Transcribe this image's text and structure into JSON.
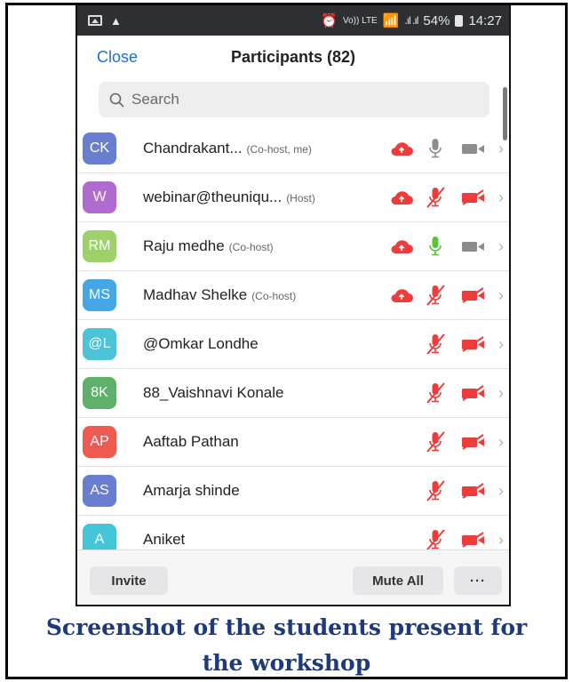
{
  "status_bar": {
    "volte": "Vo)) LTE",
    "signal": ".ıl .ıl",
    "battery_percent": "54%",
    "time": "14:27"
  },
  "header": {
    "close_label": "Close",
    "title": "Participants (82)"
  },
  "search": {
    "placeholder": "Search"
  },
  "participants": [
    {
      "initials": "CK",
      "color": "#6a7ed0",
      "name": "Chandrakant...",
      "role": "(Co-host, me)",
      "cloud": true,
      "mic": "on-grey",
      "cam": "on-grey"
    },
    {
      "initials": "W",
      "color": "#b06ad0",
      "name": "webinar@theuniqu...",
      "role": "(Host)",
      "cloud": true,
      "mic": "muted",
      "cam": "off"
    },
    {
      "initials": "RM",
      "color": "#9ed16a",
      "name": "Raju medhe",
      "role": "(Co-host)",
      "cloud": true,
      "mic": "on-green",
      "cam": "on-grey"
    },
    {
      "initials": "MS",
      "color": "#46a6e6",
      "name": "Madhav Shelke",
      "role": "(Co-host)",
      "cloud": true,
      "mic": "muted",
      "cam": "off"
    },
    {
      "initials": "@L",
      "color": "#4cc3d6",
      "name": "@Omkar Londhe",
      "role": "",
      "cloud": false,
      "mic": "muted",
      "cam": "off"
    },
    {
      "initials": "8K",
      "color": "#5fb06a",
      "name": "88_Vaishnavi Konale",
      "role": "",
      "cloud": false,
      "mic": "muted",
      "cam": "off"
    },
    {
      "initials": "AP",
      "color": "#ee5a52",
      "name": "Aaftab Pathan",
      "role": "",
      "cloud": false,
      "mic": "muted",
      "cam": "off"
    },
    {
      "initials": "AS",
      "color": "#6a7ed0",
      "name": "Amarja shinde",
      "role": "",
      "cloud": false,
      "mic": "muted",
      "cam": "off"
    },
    {
      "initials": "A",
      "color": "#44c6d8",
      "name": "Aniket",
      "role": "",
      "cloud": false,
      "mic": "muted",
      "cam": "off"
    }
  ],
  "bottom_bar": {
    "invite_label": "Invite",
    "mute_all_label": "Mute All",
    "more_label": "···"
  },
  "caption": {
    "line1": "Screenshot of the students present for",
    "line2": "the workshop"
  },
  "colors": {
    "accent_blue": "#1f6fd1",
    "muted_red": "#ee3b3b",
    "mic_green": "#59c43b",
    "caption_blue": "#1f3a7a"
  }
}
